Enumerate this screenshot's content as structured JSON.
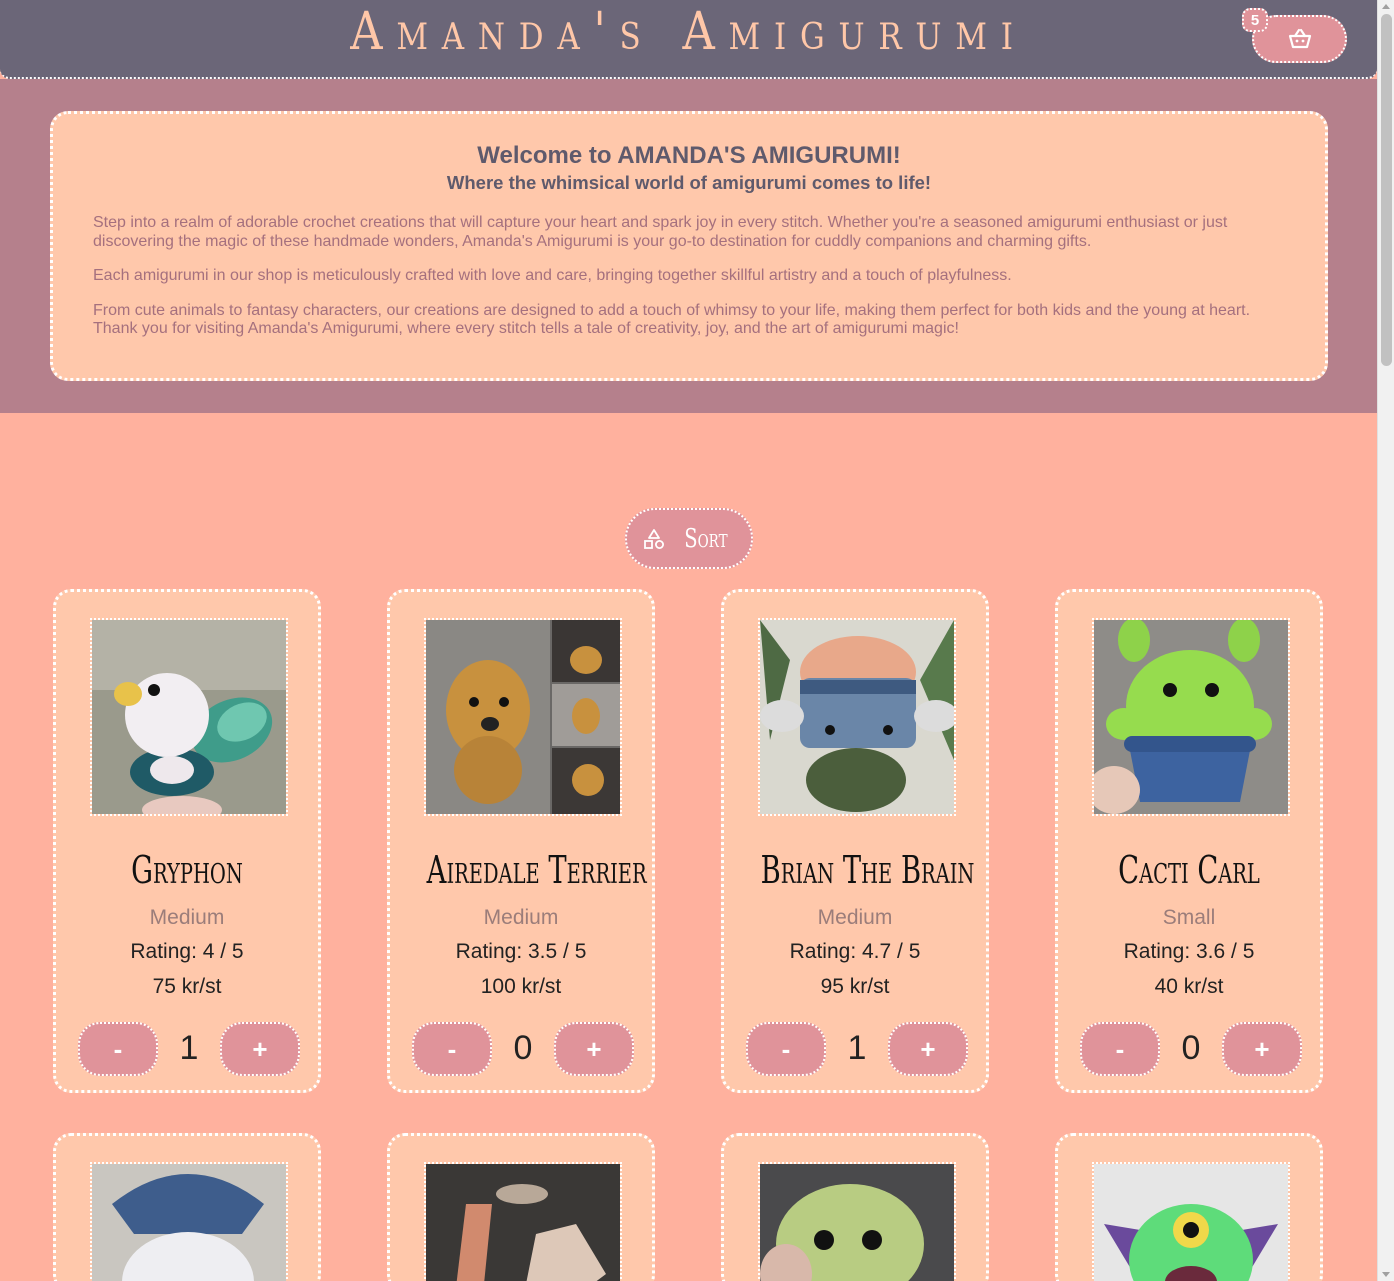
{
  "header": {
    "site_title": "Amanda's Amigurumi",
    "cart_count": "5",
    "cart_icon": "basket-icon"
  },
  "welcome": {
    "title": "Welcome to AMANDA'S AMIGURUMI!",
    "subtitle": "Where the whimsical world of amigurumi comes to life!",
    "paragraphs": [
      "Step into a realm of adorable crochet creations that will capture your heart and spark joy in every stitch. Whether you're a seasoned amigurumi enthusiast or just discovering the magic of these handmade wonders, Amanda's Amigurumi is your go-to destination for cuddly companions and charming gifts.",
      "Each amigurumi in our shop is meticulously crafted with love and care, bringing together skillful artistry and a touch of playfulness.",
      "From cute animals to fantasy characters, our creations are designed to add a touch of whimsy to your life, making them perfect for both kids and the young at heart. Thank you for visiting Amanda's Amigurumi, where every stitch tells a tale of creativity, joy, and the art of amigurumi magic!"
    ]
  },
  "sort": {
    "label": "Sort",
    "icon": "shapes-icon"
  },
  "products": [
    {
      "name": "Gryphon",
      "size": "Medium",
      "rating": "Rating: 4 / 5",
      "price": "75 kr/st",
      "qty": "1",
      "minus": "-",
      "plus": "+"
    },
    {
      "name": "Airedale Terrier",
      "size": "Medium",
      "rating": "Rating: 3.5 / 5",
      "price": "100 kr/st",
      "qty": "0",
      "minus": "-",
      "plus": "+"
    },
    {
      "name": "Brian The Brain",
      "size": "Medium",
      "rating": "Rating: 4.7 / 5",
      "price": "95 kr/st",
      "qty": "1",
      "minus": "-",
      "plus": "+"
    },
    {
      "name": "Cacti Carl",
      "size": "Small",
      "rating": "Rating: 3.6 / 5",
      "price": "40 kr/st",
      "qty": "0",
      "minus": "-",
      "plus": "+"
    }
  ],
  "colors": {
    "header_bg": "#6b6678",
    "title": "#ffc7a8",
    "band_bg": "#b5808c",
    "box_bg": "#ffc8ab",
    "page_bg": "#ffb19e",
    "button": "#e0939a"
  }
}
